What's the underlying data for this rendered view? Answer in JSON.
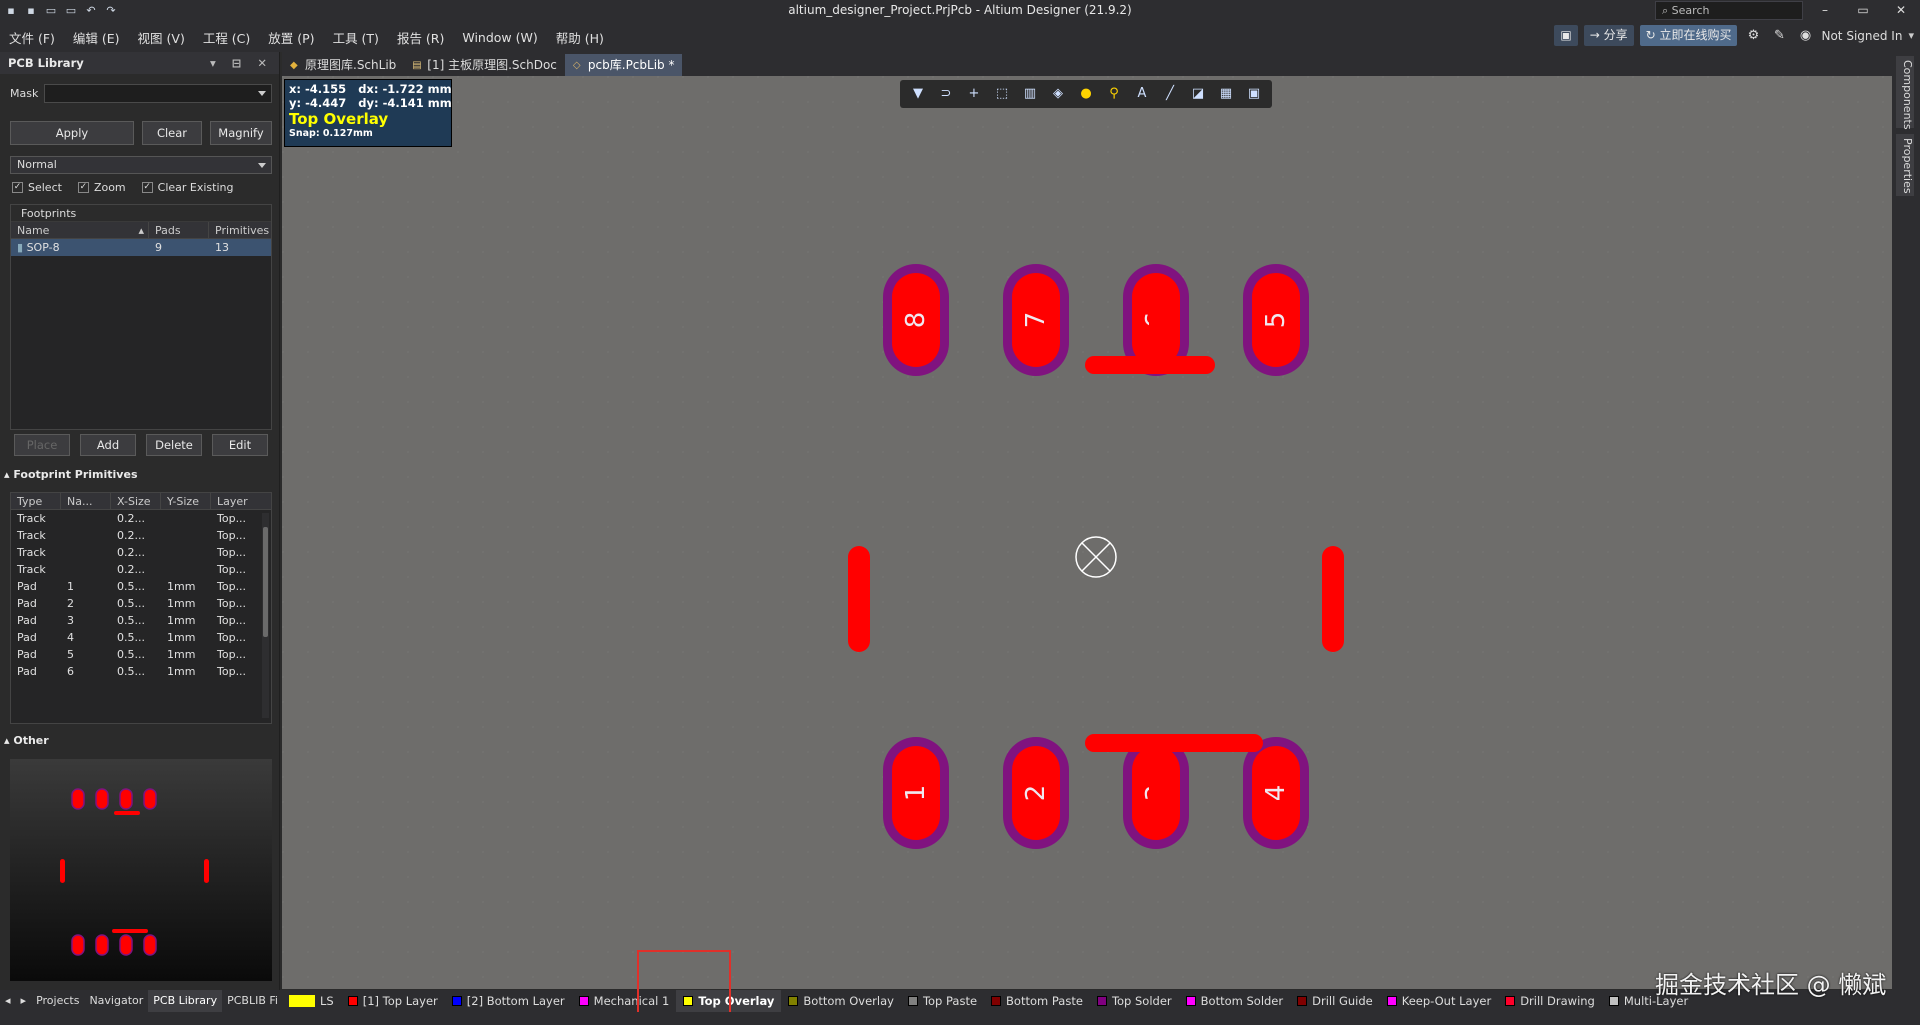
{
  "window": {
    "title": "altium_designer_Project.PrjPcb - Altium Designer (21.9.2)",
    "search_placeholder": "Search",
    "minimize": "–",
    "maximize": "▭",
    "close": "✕"
  },
  "quick_icons": [
    "save-icon",
    "save-all-icon",
    "open-icon",
    "open-project-icon",
    "undo-icon",
    "redo-icon"
  ],
  "menu": {
    "items": [
      "文件 (F)",
      "编辑 (E)",
      "视图 (V)",
      "工程 (C)",
      "放置 (P)",
      "工具 (T)",
      "报告 (R)",
      "Window (W)",
      "帮助 (H)"
    ],
    "share": "分享",
    "buy": "立即在线购买",
    "signin": "Not Signed In"
  },
  "panel": {
    "title": "PCB Library",
    "mask_label": "Mask",
    "mask_value": "",
    "apply": "Apply",
    "clear": "Clear",
    "magnify": "Magnify",
    "mode": "Normal",
    "checks": {
      "select": "Select",
      "zoom": "Zoom",
      "clear_existing": "Clear Existing"
    },
    "footprints": {
      "label": "Footprints",
      "headers": [
        "Name",
        "Pads",
        "Primitives"
      ],
      "rows": [
        {
          "name": "SOP-8",
          "pads": "9",
          "primitives": "13"
        }
      ]
    },
    "buttons": {
      "place": "Place",
      "add": "Add",
      "delete": "Delete",
      "edit": "Edit"
    },
    "primitives": {
      "label": "Footprint Primitives",
      "headers": [
        "Type",
        "Na...",
        "X-Size",
        "Y-Size",
        "Layer"
      ],
      "rows": [
        [
          "Track",
          "",
          "0.2...",
          "",
          "Top..."
        ],
        [
          "Track",
          "",
          "0.2...",
          "",
          "Top..."
        ],
        [
          "Track",
          "",
          "0.2...",
          "",
          "Top..."
        ],
        [
          "Track",
          "",
          "0.2...",
          "",
          "Top..."
        ],
        [
          "Pad",
          "1",
          "0.5...",
          "1mm",
          "Top..."
        ],
        [
          "Pad",
          "2",
          "0.5...",
          "1mm",
          "Top..."
        ],
        [
          "Pad",
          "3",
          "0.5...",
          "1mm",
          "Top..."
        ],
        [
          "Pad",
          "4",
          "0.5...",
          "1mm",
          "Top..."
        ],
        [
          "Pad",
          "5",
          "0.5...",
          "1mm",
          "Top..."
        ],
        [
          "Pad",
          "6",
          "0.5...",
          "1mm",
          "Top..."
        ]
      ]
    },
    "other_label": "Other"
  },
  "bottom_tabs": [
    "Projects",
    "Navigator",
    "PCB Library",
    "PCBLIB Fi"
  ],
  "doc_tabs": [
    {
      "label": "原理图库.SchLib",
      "active": false
    },
    {
      "label": "[1] 主板原理图.SchDoc",
      "active": false
    },
    {
      "label": "pcb库.PcbLib *",
      "active": true
    }
  ],
  "hud": {
    "x": "x: -4.155",
    "dx": "dx: -1.722 mm",
    "y": "y: -4.447",
    "dy": "dy: -4.141 mm",
    "layer": "Top Overlay",
    "snap": "Snap: 0.127mm"
  },
  "pads": {
    "top": [
      "8",
      "7",
      "6",
      "5"
    ],
    "bottom": [
      "1",
      "2",
      "3",
      "4"
    ]
  },
  "colors": {
    "pad_fill": "#ff0000",
    "pad_ring": "#80137f",
    "canvas": "#6e6d6b",
    "accent": "#4f6a8a"
  },
  "right_rail": [
    "Components",
    "Properties"
  ],
  "layers": [
    {
      "label": "LS",
      "color": "#ffff00",
      "active": false
    },
    {
      "label": "[1] Top Layer",
      "color": "#ff0000",
      "active": false
    },
    {
      "label": "[2] Bottom Layer",
      "color": "#0000ff",
      "active": false
    },
    {
      "label": "Mechanical 1",
      "color": "#ff00ff",
      "active": false
    },
    {
      "label": "Top Overlay",
      "color": "#ffff00",
      "active": true
    },
    {
      "label": "Bottom Overlay",
      "color": "#808000",
      "active": false
    },
    {
      "label": "Top Paste",
      "color": "#808080",
      "active": false
    },
    {
      "label": "Bottom Paste",
      "color": "#800000",
      "active": false
    },
    {
      "label": "Top Solder",
      "color": "#800080",
      "active": false
    },
    {
      "label": "Bottom Solder",
      "color": "#ff00ff",
      "active": false
    },
    {
      "label": "Drill Guide",
      "color": "#800000",
      "active": false
    },
    {
      "label": "Keep-Out Layer",
      "color": "#ff00ff",
      "active": false
    },
    {
      "label": "Drill Drawing",
      "color": "#ff002a",
      "active": false
    },
    {
      "label": "Multi-Layer",
      "color": "#c0c0c0",
      "active": false
    }
  ],
  "watermark": "掘金技术社区 @ 懒斌"
}
